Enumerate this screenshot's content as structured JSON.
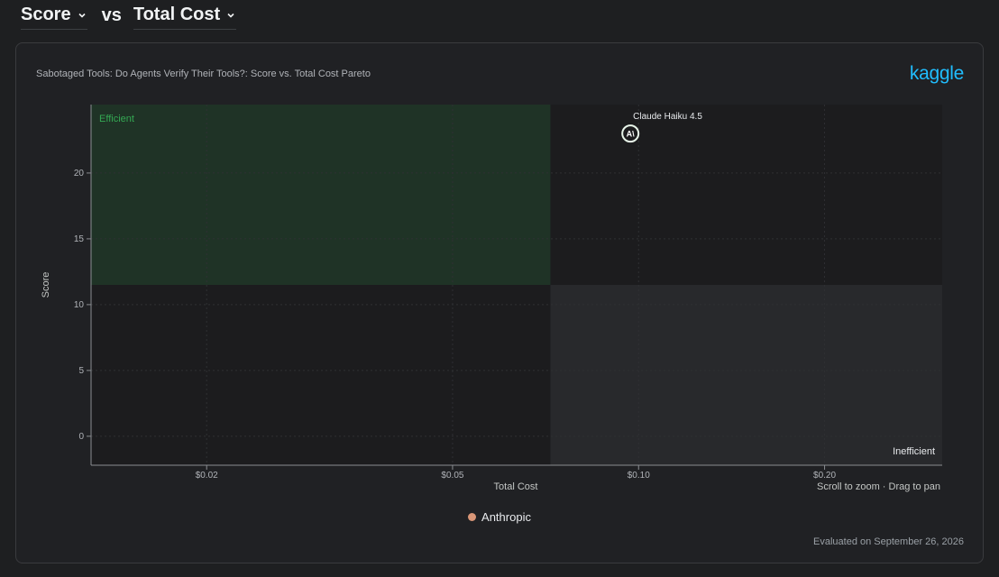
{
  "header": {
    "y_metric": "Score",
    "vs": "vs",
    "x_metric": "Total Cost"
  },
  "card": {
    "title": "Sabotaged Tools: Do Agents Verify Their Tools?: Score vs. Total Cost Pareto",
    "logo": "kaggle",
    "hint": "Scroll to zoom · Drag to pan",
    "evaluated": "Evaluated on September 26, 2026"
  },
  "colors": {
    "efficient_region": "#1f3326",
    "efficient_label": "#34a853",
    "inefficient_region": "#28292c",
    "anthropic": "#d99677",
    "logo": "#20beff"
  },
  "chart_data": {
    "type": "scatter",
    "x_scale": "log",
    "xlabel": "Total Cost",
    "ylabel": "Score",
    "xlim": [
      0.013,
      0.31
    ],
    "ylim": [
      -2.2,
      25.2
    ],
    "x_ticks": [
      0.02,
      0.05,
      0.1,
      0.2
    ],
    "x_tick_labels": [
      "$0.02",
      "$0.05",
      "$0.10",
      "$0.20"
    ],
    "y_ticks": [
      0,
      5,
      10,
      15,
      20
    ],
    "y_tick_labels": [
      "0",
      "5",
      "10",
      "15",
      "20"
    ],
    "regions": [
      {
        "label": "Efficient",
        "x_range": [
          0.013,
          0.072
        ],
        "y_range": [
          11.5,
          25.2
        ]
      },
      {
        "label": "Inefficient",
        "x_range": [
          0.072,
          0.31
        ],
        "y_range": [
          -2.2,
          11.5
        ]
      }
    ],
    "points": [
      {
        "label": "Claude Haiku 4.5",
        "x": 0.097,
        "y": 23,
        "provider": "Anthropic",
        "icon": "anthropic-icon"
      }
    ],
    "legend": [
      {
        "name": "Anthropic"
      }
    ],
    "grid": true
  }
}
